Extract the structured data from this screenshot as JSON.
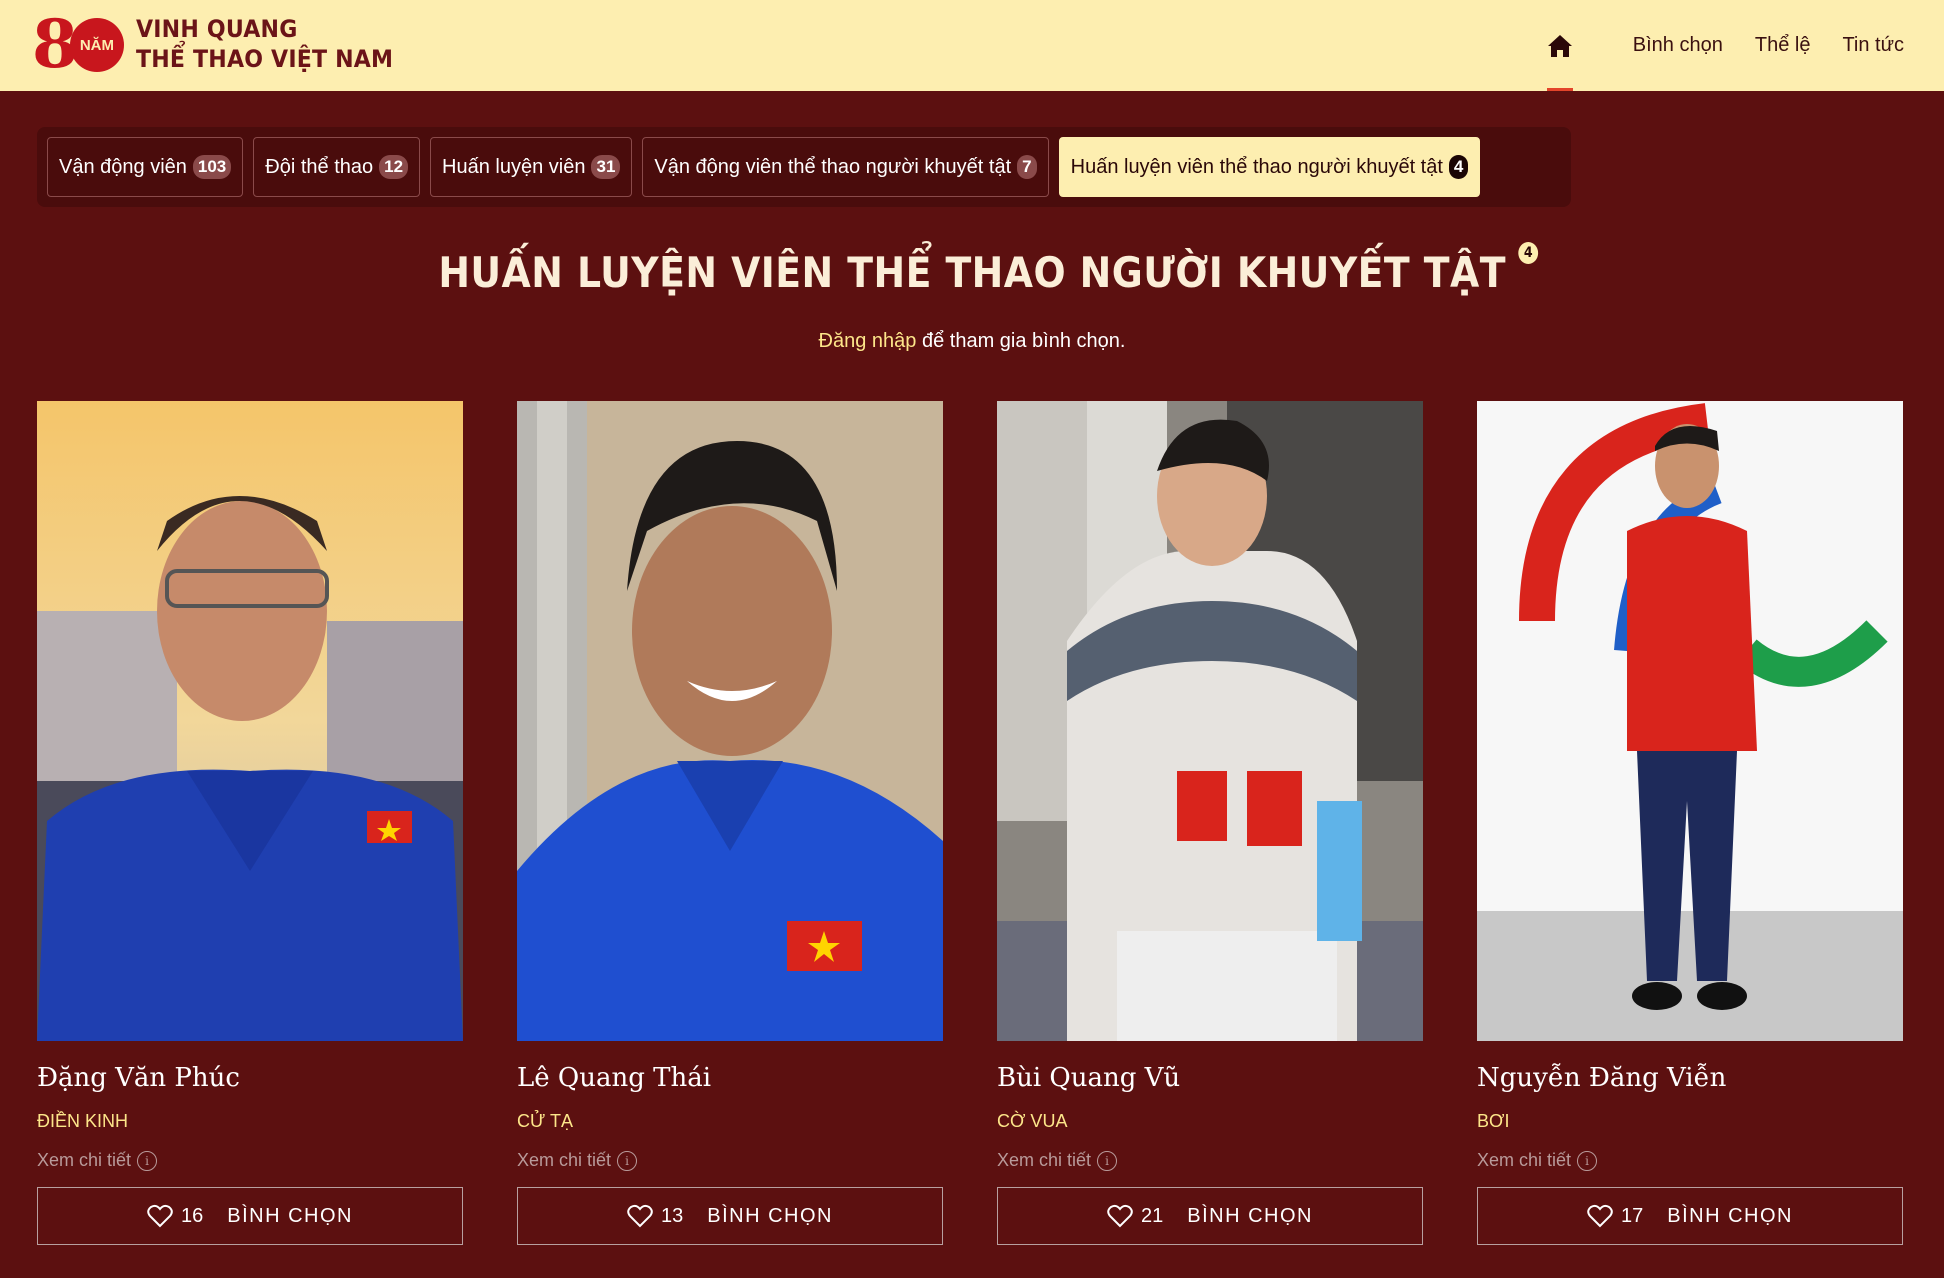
{
  "header": {
    "logo_number": "8",
    "logo_badge": "NĂM",
    "logo_line1": "VINH QUANG",
    "logo_line2": "THỂ THAO VIỆT NAM",
    "nav": [
      "Bình chọn",
      "Thể lệ",
      "Tin tức"
    ]
  },
  "tabs": [
    {
      "label": "Vận động viên",
      "count": "103"
    },
    {
      "label": "Đội thể thao",
      "count": "12"
    },
    {
      "label": "Huấn luyện viên",
      "count": "31"
    },
    {
      "label": "Vận động viên thể thao người khuyết tật",
      "count": "7"
    },
    {
      "label": "Huấn luyện viên thể thao người khuyết tật",
      "count": "4"
    }
  ],
  "section": {
    "title": "HUẤN LUYỆN VIÊN THỂ THAO NGƯỜI KHUYẾT TẬT",
    "count": "4",
    "login_link": "Đăng nhập",
    "login_text": " để tham gia bình chọn."
  },
  "cards": [
    {
      "name": "Đặng Văn Phúc",
      "sport": "ĐIỀN KINH",
      "detail": "Xem chi tiết",
      "votes": "16",
      "vote_label": "BÌNH CHỌN"
    },
    {
      "name": "Lê Quang Thái",
      "sport": "CỬ TẠ",
      "detail": "Xem chi tiết",
      "votes": "13",
      "vote_label": "BÌNH CHỌN"
    },
    {
      "name": "Bùi Quang Vũ",
      "sport": "CỜ VUA",
      "detail": "Xem chi tiết",
      "votes": "21",
      "vote_label": "BÌNH CHỌN"
    },
    {
      "name": "Nguyễn Đăng Viễn",
      "sport": "BƠI",
      "detail": "Xem chi tiết",
      "votes": "17",
      "vote_label": "BÌNH CHỌN"
    }
  ],
  "colors": {
    "background": "#5c1010",
    "header": "#fdeeb0",
    "accent": "#fde68a",
    "logo_red": "#c8161d"
  }
}
